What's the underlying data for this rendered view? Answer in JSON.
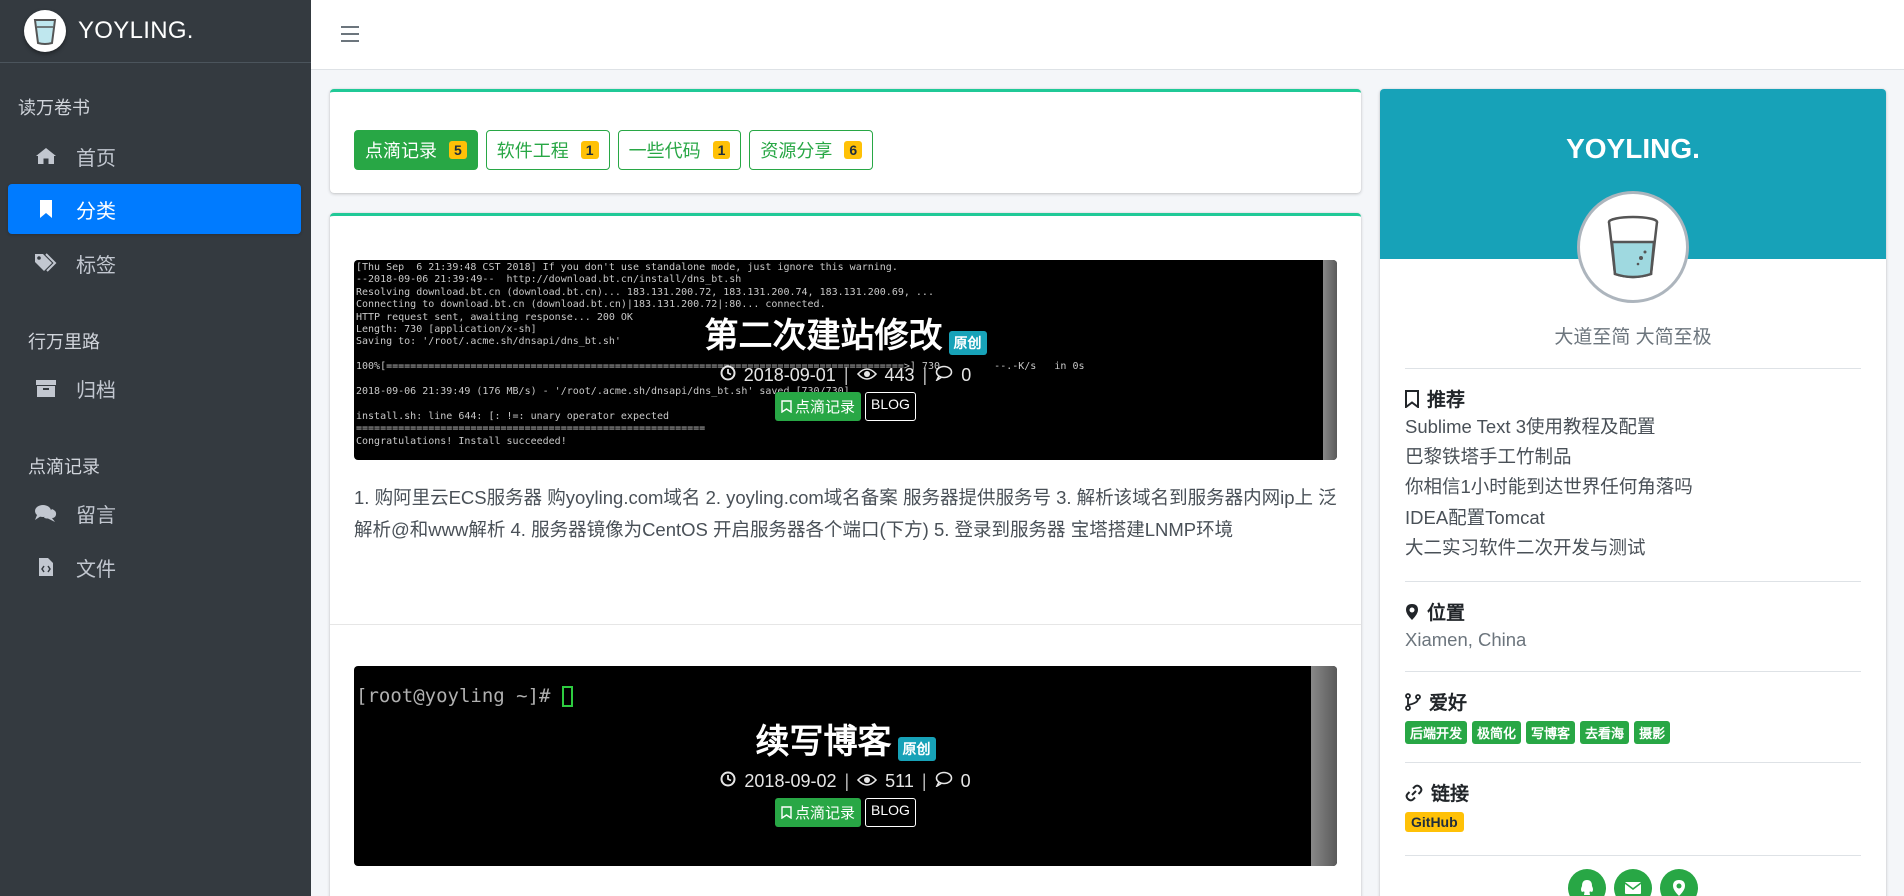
{
  "sidebar": {
    "brand": "YOYLING.",
    "sections": [
      {
        "header": "读万卷书",
        "items": [
          {
            "label": "首页",
            "icon": "home-icon"
          },
          {
            "label": "分类",
            "icon": "bookmark-icon"
          },
          {
            "label": "标签",
            "icon": "tags-icon"
          }
        ]
      },
      {
        "header": "行万里路",
        "items": [
          {
            "label": "归档",
            "icon": "archive-icon"
          }
        ]
      },
      {
        "header": "点滴记录",
        "items": [
          {
            "label": "留言",
            "icon": "comments-icon"
          },
          {
            "label": "文件",
            "icon": "file-code-icon"
          }
        ]
      }
    ],
    "active_color": "#007bff",
    "bg_color": "#343a40"
  },
  "categories": [
    {
      "label": "点滴记录",
      "count": "5"
    },
    {
      "label": "软件工程",
      "count": "1"
    },
    {
      "label": "一些代码",
      "count": "1"
    },
    {
      "label": "资源分享",
      "count": "6"
    }
  ],
  "posts": [
    {
      "title": "第二次建站修改",
      "badge": "原创",
      "date": "2018-09-01",
      "views": "443",
      "comments": "0",
      "tag1": "点滴记录",
      "tag2": "BLOG",
      "excerpt": "1. 购阿里云ECS服务器 购yoyling.com域名 2. yoyling.com域名备案 服务器提供服务号 3. 解析该域名到服务器内网ip上 泛解析@和www解析 4. 服务器镜像为CentOS 开启服务器各个端口(下方) 5. 登录到服务器 宝塔搭建LNMP环境",
      "terminal": "[Thu Sep  6 21:39:48 CST 2018] If you don't use standalone mode, just ignore this warning.\n--2018-09-06 21:39:49--  http://download.bt.cn/install/dns_bt.sh\nResolving download.bt.cn (download.bt.cn)... 183.131.200.72, 183.131.200.74, 183.131.200.69, ...\nConnecting to download.bt.cn (download.bt.cn)|183.131.200.72|:80... connected.\nHTTP request sent, awaiting response... 200 OK\nLength: 730 [application/x-sh]\nSaving to: '/root/.acme.sh/dnsapi/dns_bt.sh'\n\n100%[======================================================================================>] 730         --.-K/s   in 0s\n\n2018-09-06 21:39:49 (176 MB/s) - '/root/.acme.sh/dnsapi/dns_bt.sh' saved [730/730]\n\ninstall.sh: line 644: [: !=: unary operator expected\n==========================================================\nCongratulations! Install succeeded!"
    },
    {
      "title": "续写博客",
      "badge": "原创",
      "date": "2018-09-02",
      "views": "511",
      "comments": "0",
      "tag1": "点滴记录",
      "tag2": "BLOG",
      "terminal": "[root@yoyling ~]# "
    }
  ],
  "profile": {
    "name": "YOYLING.",
    "motto": "大道至简 大简至极",
    "recommend_title": "推荐",
    "recommend": [
      "Sublime Text 3使用教程及配置",
      "巴黎铁塔手工竹制品",
      "你相信1小时能到达世界任何角落吗",
      "IDEA配置Tomcat",
      "大二实习软件二次开发与测试"
    ],
    "location_title": "位置",
    "location": "Xiamen, China",
    "hobby_title": "爱好",
    "hobbies": [
      "后端开发",
      "极简化",
      "写博客",
      "去看海",
      "摄影"
    ],
    "link_title": "链接",
    "link": "GitHub",
    "header_color": "#17a2b8"
  }
}
